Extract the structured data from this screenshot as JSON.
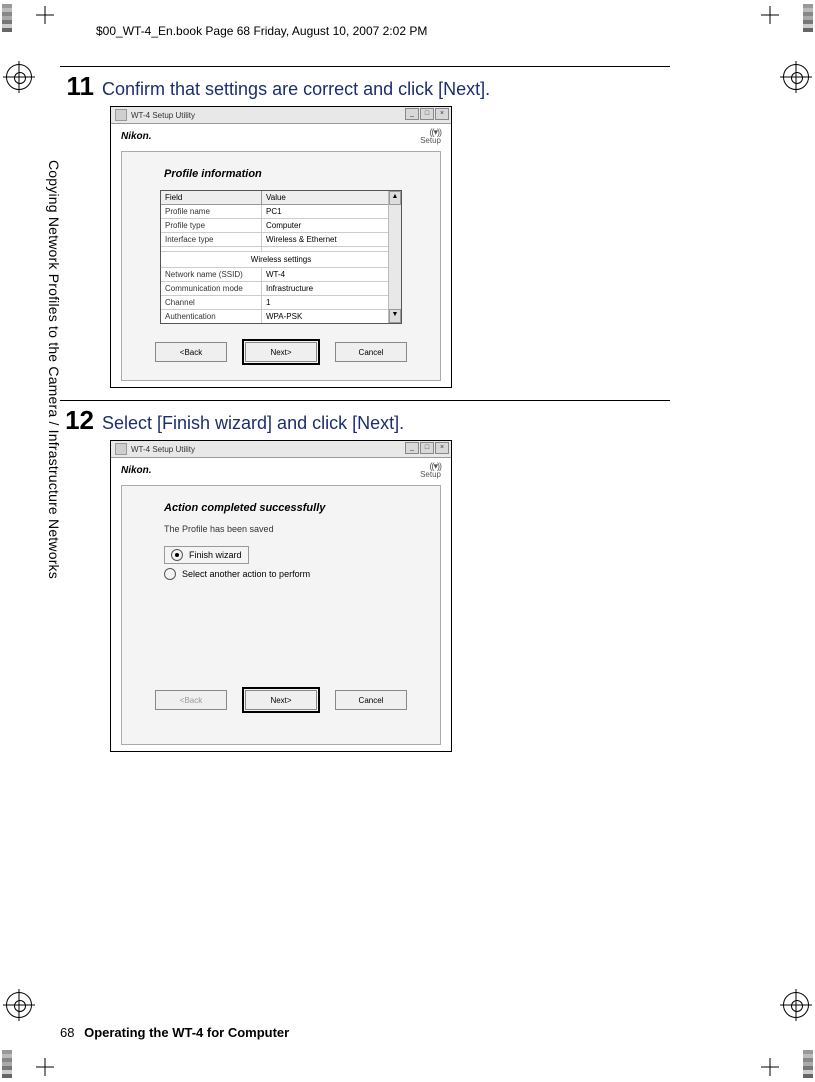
{
  "header_line": "$00_WT-4_En.book  Page 68  Friday, August 10, 2007  2:02 PM",
  "side_text": "Copying Network Profiles to the Camera / Infrastructure Networks",
  "steps": {
    "s11": {
      "num": "11",
      "text": "Confirm that settings are correct and click [Next]."
    },
    "s12": {
      "num": "12",
      "text": "Select [Finish wizard] and click [Next]."
    }
  },
  "window": {
    "title": "WT-4 Setup Utility",
    "brand": "Nikon.",
    "setup_label": "Setup",
    "buttons": {
      "back": "<Back",
      "next": "Next>",
      "cancel": "Cancel"
    }
  },
  "screen1": {
    "title": "Profile information",
    "head_field": "Field",
    "head_value": "Value",
    "rows": {
      "r1": {
        "f": "Profile name",
        "v": "PC1"
      },
      "r2": {
        "f": "Profile type",
        "v": "Computer"
      },
      "r3": {
        "f": "Interface type",
        "v": "Wireless & Ethernet"
      }
    },
    "subhead": "Wireless settings",
    "rows2": {
      "r4": {
        "f": "Network name (SSID)",
        "v": "WT-4"
      },
      "r5": {
        "f": "Communication mode",
        "v": "Infrastructure"
      },
      "r6": {
        "f": "Channel",
        "v": "1"
      },
      "r7": {
        "f": "Authentication",
        "v": "WPA-PSK"
      }
    }
  },
  "screen2": {
    "title": "Action completed successfully",
    "sub": "The Profile has been saved",
    "opt1": "Finish wizard",
    "opt2": "Select another action to perform"
  },
  "footer": {
    "page_num": "68",
    "title": "Operating the WT-4 for Computer"
  }
}
